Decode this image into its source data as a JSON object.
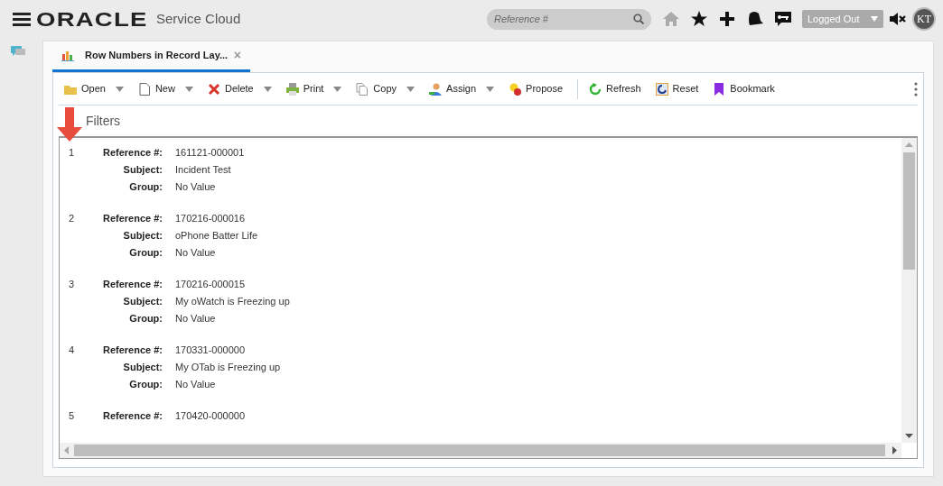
{
  "header": {
    "logo": "ORACLE",
    "product": "Service Cloud",
    "search": {
      "placeholder": "Reference #"
    },
    "status": "Logged Out",
    "avatar": "KT"
  },
  "tabs": [
    {
      "label": "Row Numbers in Record Lay...",
      "selected": true,
      "close": "×"
    }
  ],
  "toolbar": {
    "groups": [
      [
        {
          "label": "Open",
          "dropdown": true
        },
        {
          "label": "New",
          "dropdown": true
        },
        {
          "label": "Delete",
          "dropdown": true
        },
        {
          "label": "Print",
          "dropdown": true
        },
        {
          "label": "Copy",
          "dropdown": true
        },
        {
          "label": "Assign",
          "dropdown": true
        },
        {
          "label": "Propose",
          "dropdown": false
        }
      ],
      [
        {
          "label": "Refresh",
          "dropdown": false
        },
        {
          "label": "Reset",
          "dropdown": false
        },
        {
          "label": "Bookmark",
          "dropdown": false
        }
      ]
    ]
  },
  "filters_label": "Filters",
  "records": [
    {
      "number": "1",
      "fields": [
        {
          "label": "Reference #:",
          "value": "161121-000001"
        },
        {
          "label": "Subject:",
          "value": "Incident Test"
        },
        {
          "label": "Group:",
          "value": "No Value"
        }
      ]
    },
    {
      "number": "2",
      "fields": [
        {
          "label": "Reference #:",
          "value": "170216-000016"
        },
        {
          "label": "Subject:",
          "value": "oPhone Batter Life"
        },
        {
          "label": "Group:",
          "value": "No Value"
        }
      ]
    },
    {
      "number": "3",
      "fields": [
        {
          "label": "Reference #:",
          "value": "170216-000015"
        },
        {
          "label": "Subject:",
          "value": "My oWatch is Freezing up"
        },
        {
          "label": "Group:",
          "value": "No Value"
        }
      ]
    },
    {
      "number": "4",
      "fields": [
        {
          "label": "Reference #:",
          "value": "170331-000000"
        },
        {
          "label": "Subject:",
          "value": "My OTab is Freezing up"
        },
        {
          "label": "Group:",
          "value": "No Value"
        }
      ]
    },
    {
      "number": "5",
      "fields": [
        {
          "label": "Reference #:",
          "value": "170420-000000"
        }
      ]
    }
  ]
}
